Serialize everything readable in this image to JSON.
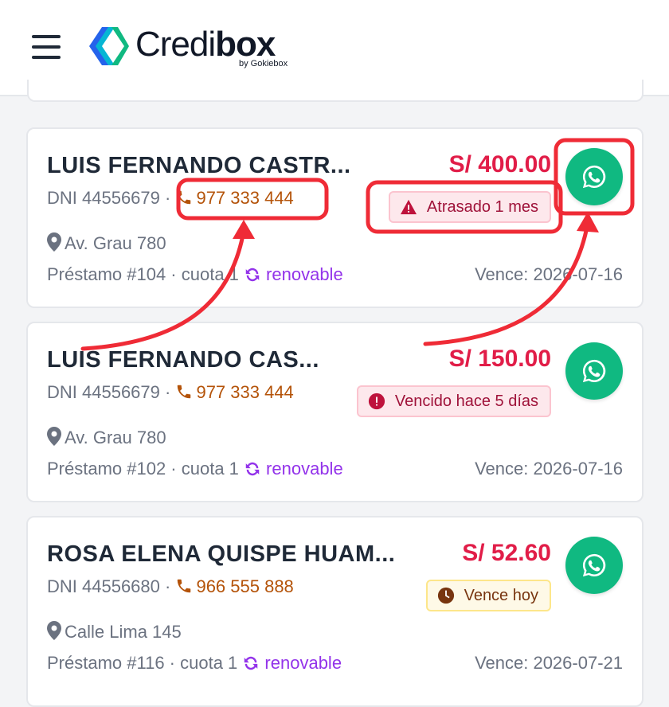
{
  "header": {
    "brand_light": "Credi",
    "brand_bold": "box",
    "brand_sub": "by Gokiebox"
  },
  "colors": {
    "amount": "#e11d48",
    "phone": "#b45309",
    "renovable": "#9333ea",
    "whatsapp": "#10b981",
    "highlight": "#ef2b36"
  },
  "cards": [
    {
      "name": "LUIS FERNANDO CASTR...",
      "amount": "S/ 400.00",
      "dni": "DNI 44556679",
      "phone": "977 333 444",
      "badge": "Atrasado 1 mes",
      "badge_icon": "warning-triangle-icon",
      "address": "Av. Grau 780",
      "loan": "Préstamo #104 · cuota 1",
      "renovable": "renovable",
      "due": "Vence: 2026-07-16"
    },
    {
      "name": "LUIS FERNANDO CAS...",
      "amount": "S/ 150.00",
      "dni": "DNI 44556679",
      "phone": "977 333 444",
      "badge": "Vencido hace 5 días",
      "badge_icon": "exclamation-circle-icon",
      "address": "Av. Grau 780",
      "loan": "Préstamo #102 · cuota 1",
      "renovable": "renovable",
      "due": "Vence: 2026-07-16"
    },
    {
      "name": "ROSA ELENA QUISPE HUAM...",
      "amount": "S/ 52.60",
      "dni": "DNI 44556680",
      "phone": "966 555 888",
      "badge": "Vence hoy",
      "badge_icon": "clock-icon",
      "address": "Calle Lima 145",
      "loan": "Préstamo #116 · cuota 1",
      "renovable": "renovable",
      "due": "Vence: 2026-07-21"
    }
  ]
}
